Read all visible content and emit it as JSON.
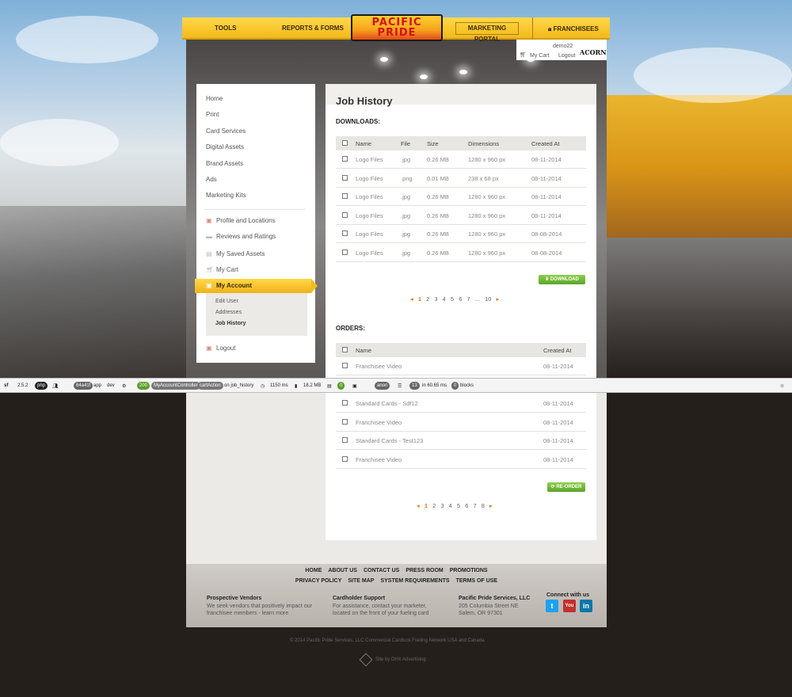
{
  "topnav": {
    "tools": "TOOLS",
    "reports": "REPORTS & FORMS",
    "logo_line1": "PACIFIC",
    "logo_line2": "PRIDE",
    "marketing": "MARKETING PORTAL",
    "franchisees": "FRANCHISEES"
  },
  "user": {
    "name": "demo22",
    "cart": "My Cart",
    "logout": "Logout",
    "brand": "ACORN"
  },
  "sidebar": {
    "top": [
      "Home",
      "Print",
      "Card Services",
      "Digital Assets",
      "Brand Assets",
      "Ads",
      "Marketing Kits"
    ],
    "account": [
      "Profile and Locations",
      "Reviews and Ratings",
      "My Saved Assets",
      "My Cart",
      "My Account"
    ],
    "sub": [
      "Edit User",
      "Addresses",
      "Job History"
    ],
    "logout": "Logout"
  },
  "main": {
    "title": "Job History",
    "downloads_label": "DOWNLOADS:",
    "orders_label": "ORDERS:",
    "dl_headers": [
      "Name",
      "File",
      "Size",
      "Dimensions",
      "Created At"
    ],
    "dl_rows": [
      [
        "Logo Files",
        ".jpg",
        "0.26 MB",
        "1280 x 960 px",
        "08-11-2014"
      ],
      [
        "Logo Files",
        ".png",
        "0.01 MB",
        "238 x 68 px",
        "08-11-2014"
      ],
      [
        "Logo Files",
        ".jpg",
        "0.26 MB",
        "1280 x 960 px",
        "08-11-2014"
      ],
      [
        "Logo Files",
        ".jpg",
        "0.26 MB",
        "1280 x 960 px",
        "08-11-2014"
      ],
      [
        "Logo Files",
        ".jpg",
        "0.26 MB",
        "1280 x 960 px",
        "08-08-2014"
      ],
      [
        "Logo Files",
        ".jpg",
        "0.26 MB",
        "1280 x 960 px",
        "08-08-2014"
      ]
    ],
    "download_btn": "DOWNLOAD",
    "dl_pages": [
      "1",
      "2",
      "3",
      "4",
      "5",
      "6",
      "7",
      "...",
      "10"
    ],
    "ord_headers": [
      "Name",
      "Created At"
    ],
    "ord_rows": [
      [
        "Franchisee Video",
        "08-11-2014"
      ],
      [
        "Standard Cards - Sdf12",
        "08-11-2014"
      ],
      [
        "Franchisee Video",
        "08-11-2014"
      ],
      [
        "Standard Cards - Test123",
        "08-11-2014"
      ],
      [
        "Franchisee Video",
        "08-11-2014"
      ]
    ],
    "reorder_btn": "RE-ORDER",
    "ord_pages": [
      "1",
      "2",
      "3",
      "4",
      "5",
      "6",
      "7",
      "8"
    ]
  },
  "toolbar": {
    "sf": "2.5.2",
    "hash": "64a41f",
    "app": "app",
    "env": "dev",
    "status": "200",
    "controller": "MyAccountController",
    "action": "cartAction",
    "route": "on job_history",
    "time": "1150 ms",
    "memory": "18.2 MB",
    "zero": "0",
    "user": "anon",
    "queries": "13",
    "query_time": "in 60.65 ms",
    "blocks_count": "0",
    "blocks": "blocks"
  },
  "footer": {
    "links_row1": [
      "HOME",
      "ABOUT US",
      "CONTACT US",
      "PRESS ROOM",
      "PROMOTIONS"
    ],
    "links_row2": [
      "PRIVACY POLICY",
      "SITE MAP",
      "SYSTEM REQUIREMENTS",
      "TERMS OF USE"
    ],
    "vendors_title": "Prospective Vendors",
    "vendors_text": "We seek vendors that positively impact our franchisee members - learn more",
    "support_title": "Cardholder Support",
    "support_text": "For assistance, contact your marketer, located on the front of your fueling card",
    "company_title": "Pacific Pride Services, LLC",
    "address1": "205 Columbia Street NE",
    "address2": "Salem, OR 97301",
    "connect": "Connect with us",
    "copyright": "© 2014 Pacific Pride Services, LLC   Commercial Cardlock Fueling Network   USA and Canada",
    "dhx": "Site by DHX Advertising"
  }
}
